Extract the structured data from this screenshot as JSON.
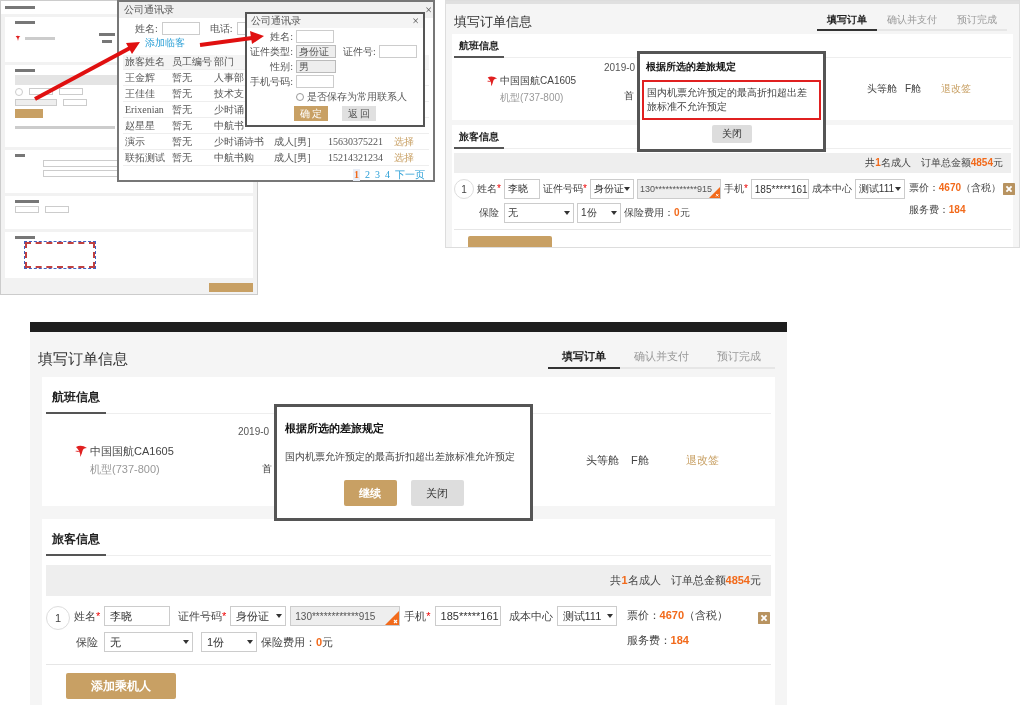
{
  "contacts_dialog": {
    "title": "公司通讯录",
    "close": "×",
    "name_label": "姓名:",
    "phone_label": "电话:",
    "add_link": "添加临客",
    "columns": [
      "旅客姓名",
      "员工编号",
      "部门"
    ],
    "rows": [
      {
        "cells": [
          "王金辉",
          "暂无",
          "人事部"
        ]
      },
      {
        "cells": [
          "王佳佳",
          "暂无",
          "技术支"
        ]
      },
      {
        "cells": [
          "Erixenian",
          "暂无",
          "少时诵"
        ]
      },
      {
        "cells": [
          "赵星星",
          "暂无",
          "中航书"
        ]
      },
      {
        "cells": [
          "演示",
          "暂无",
          "少时诵诗书",
          "成人[男]",
          "15630375221",
          "选择"
        ]
      },
      {
        "cells": [
          "联拓测试",
          "暂无",
          "中航书购",
          "成人[男]",
          "15214321234",
          "选择"
        ]
      }
    ],
    "pages": [
      {
        "label": "1",
        "selected": true
      },
      {
        "label": "2",
        "selected": false
      },
      {
        "label": "3",
        "selected": false
      },
      {
        "label": "4",
        "selected": false
      }
    ],
    "next": "下一页"
  },
  "add_dialog": {
    "title": "公司通讯录",
    "close": "×",
    "name_label": "姓名:",
    "id_type_label": "证件类型:",
    "id_type": "身份证",
    "id_number_label": "证件号:",
    "gender_label": "性别:",
    "gender": "男",
    "mobile_label": "手机号码:",
    "save_label": "是否保存为常用联系人",
    "save_checked": false,
    "confirm": "确 定",
    "back": "返 回"
  },
  "order_screens": [
    {
      "dark_top_bar": false,
      "title": "填写订单信息",
      "steps": [
        {
          "label": "填写订单",
          "selected": true
        },
        {
          "label": "确认并支付",
          "selected": false
        },
        {
          "label": "预订完成",
          "selected": false
        }
      ],
      "flight": {
        "section_title": "航班信息",
        "airline": "中国国航CA1605",
        "aircraft": "机型(737-800)",
        "date": "2019-0",
        "airport": "首",
        "cabin": "头等舱",
        "cabin_class": "F舱",
        "rules_link": "退改签"
      },
      "dialog": {
        "title": "根据所选的差旅规定",
        "message": "国内机票允许预定的最高折扣超出差旅标准不允许预定",
        "highlighted": true,
        "buttons": [
          {
            "label": "关闭",
            "kind": "secondary"
          }
        ]
      },
      "passengers": {
        "section_title": "旅客信息",
        "count": "共**1**名成人",
        "total": "订单总金额**4854**元",
        "index": "1",
        "name_label": "姓名",
        "name_mark": "*",
        "name": "李晓",
        "id_label": "证件号码",
        "id_mark": "*",
        "id_type": "身份证",
        "id_number": "130************915",
        "phone_label": "手机",
        "phone_mark": "*",
        "phone": "185*****161",
        "cost_center_label": "成本中心",
        "cost_center": "测试111",
        "price": "票价：**4670**（含税）",
        "service_fee": "服务费：**184**",
        "insurance_label": "保险",
        "insurance": "无",
        "copies": "1份",
        "insurance_fee": "保险费用：**0**元"
      }
    },
    {
      "dark_top_bar": true,
      "title": "填写订单信息",
      "steps": [
        {
          "label": "填写订单",
          "selected": true
        },
        {
          "label": "确认并支付",
          "selected": false
        },
        {
          "label": "预订完成",
          "selected": false
        }
      ],
      "flight": {
        "section_title": "航班信息",
        "airline": "中国国航CA1605",
        "aircraft": "机型(737-800)",
        "date": "2019-0",
        "airport": "首",
        "cabin": "头等舱",
        "cabin_class": "F舱",
        "rules_link": "退改签"
      },
      "dialog": {
        "title": "根据所选的差旅规定",
        "message": "国内机票允许预定的最高折扣超出差旅标准允许预定",
        "highlighted": false,
        "buttons": [
          {
            "label": "继续",
            "kind": "primary"
          },
          {
            "label": "关闭",
            "kind": "secondary"
          }
        ]
      },
      "passengers": {
        "section_title": "旅客信息",
        "count": "共**1**名成人",
        "total": "订单总金额**4854**元",
        "index": "1",
        "name_label": "姓名",
        "name_mark": "*",
        "name": "李晓",
        "id_label": "证件号码",
        "id_mark": "*",
        "id_type": "身份证",
        "id_number": "130************915",
        "phone_label": "手机",
        "phone_mark": "*",
        "phone": "185*****161",
        "cost_center_label": "成本中心",
        "cost_center": "测试111",
        "price": "票价：**4670**（含税）",
        "service_fee": "服务费：**184**",
        "insurance_label": "保险",
        "insurance": "无",
        "copies": "1份",
        "insurance_fee": "保险费用：**0**元",
        "add_button": "添加乘机人"
      }
    }
  ]
}
